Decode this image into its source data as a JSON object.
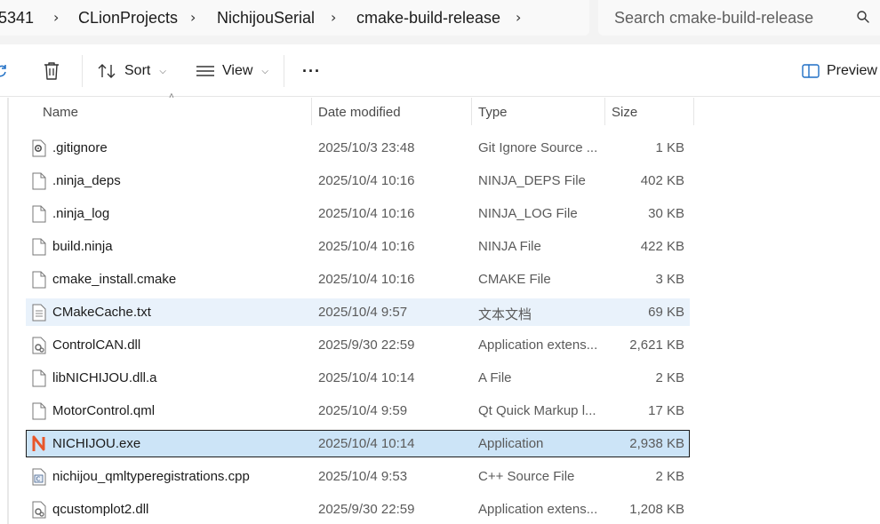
{
  "breadcrumb": {
    "items": [
      "5341",
      "CLionProjects",
      "NichijouSerial",
      "cmake-build-release"
    ]
  },
  "search": {
    "placeholder": "Search cmake-build-release"
  },
  "toolbar": {
    "sort_label": "Sort",
    "view_label": "View",
    "more_label": "···",
    "preview_label": "Preview"
  },
  "columns": {
    "name": "Name",
    "date": "Date modified",
    "type": "Type",
    "size": "Size"
  },
  "files": [
    {
      "name": ".gitignore",
      "date": "2025/10/3 23:48",
      "type": "Git Ignore Source ...",
      "size": "1 KB",
      "icon": "gear-file-icon"
    },
    {
      "name": ".ninja_deps",
      "date": "2025/10/4 10:16",
      "type": "NINJA_DEPS File",
      "size": "402 KB",
      "icon": "file-icon"
    },
    {
      "name": ".ninja_log",
      "date": "2025/10/4 10:16",
      "type": "NINJA_LOG File",
      "size": "30 KB",
      "icon": "file-icon"
    },
    {
      "name": "build.ninja",
      "date": "2025/10/4 10:16",
      "type": "NINJA File",
      "size": "422 KB",
      "icon": "file-icon"
    },
    {
      "name": "cmake_install.cmake",
      "date": "2025/10/4 10:16",
      "type": "CMAKE File",
      "size": "3 KB",
      "icon": "file-icon"
    },
    {
      "name": "CMakeCache.txt",
      "date": "2025/10/4 9:57",
      "type": "文本文档",
      "size": "69 KB",
      "icon": "text-file-icon"
    },
    {
      "name": "ControlCAN.dll",
      "date": "2025/9/30 22:59",
      "type": "Application extens...",
      "size": "2,621 KB",
      "icon": "dll-file-icon"
    },
    {
      "name": "libNICHIJOU.dll.a",
      "date": "2025/10/4 10:14",
      "type": "A File",
      "size": "2 KB",
      "icon": "file-icon"
    },
    {
      "name": "MotorControl.qml",
      "date": "2025/10/4 9:59",
      "type": "Qt Quick Markup l...",
      "size": "17 KB",
      "icon": "file-icon"
    },
    {
      "name": "NICHIJOU.exe",
      "date": "2025/10/4 10:14",
      "type": "Application",
      "size": "2,938 KB",
      "icon": "app-exe-icon"
    },
    {
      "name": "nichijou_qmltyperegistrations.cpp",
      "date": "2025/10/4 9:53",
      "type": "C++ Source File",
      "size": "2 KB",
      "icon": "cpp-file-icon"
    },
    {
      "name": "qcustomplot2.dll",
      "date": "2025/9/30 22:59",
      "type": "Application extens...",
      "size": "1,208 KB",
      "icon": "dll-file-icon"
    }
  ],
  "colors": {
    "selected": "#cce4f7",
    "hover": "#e9f2fb",
    "exe_icon": "#e8562a"
  }
}
